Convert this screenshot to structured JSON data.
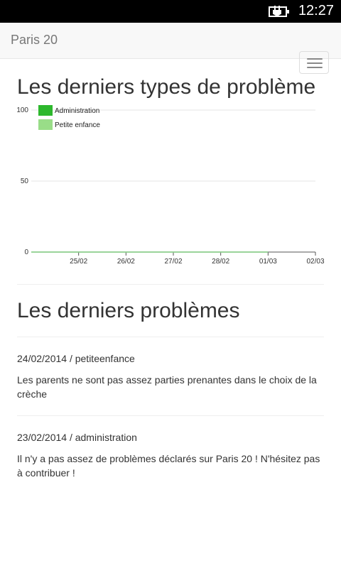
{
  "status_bar": {
    "time": "12:27"
  },
  "navbar": {
    "brand": "Paris 20"
  },
  "section_types": {
    "heading": "Les derniers types de problème"
  },
  "section_problems": {
    "heading": "Les derniers problèmes"
  },
  "problems": [
    {
      "meta": "24/02/2014 / petiteenfance",
      "text": "Les parents ne sont pas assez parties prenantes dans le choix de la crèche"
    },
    {
      "meta": "23/02/2014 / administration",
      "text": "Il n'y a pas assez de problèmes déclarés sur Paris 20 ! N'hésitez pas à contribuer !"
    }
  ],
  "chart_data": {
    "type": "line",
    "categories": [
      "25/02",
      "26/02",
      "27/02",
      "28/02",
      "01/03",
      "02/03"
    ],
    "series": [
      {
        "name": "Administration",
        "values": [
          0,
          0,
          0,
          0,
          0,
          0
        ],
        "color": "#2db82d"
      },
      {
        "name": "Petite enfance",
        "values": [
          0,
          0,
          0,
          0,
          0,
          0
        ],
        "color": "#99dd88"
      }
    ],
    "yticks": [
      "0",
      "50",
      "100"
    ],
    "ylim": [
      0,
      100
    ],
    "legend": "top-left",
    "grid": true
  }
}
